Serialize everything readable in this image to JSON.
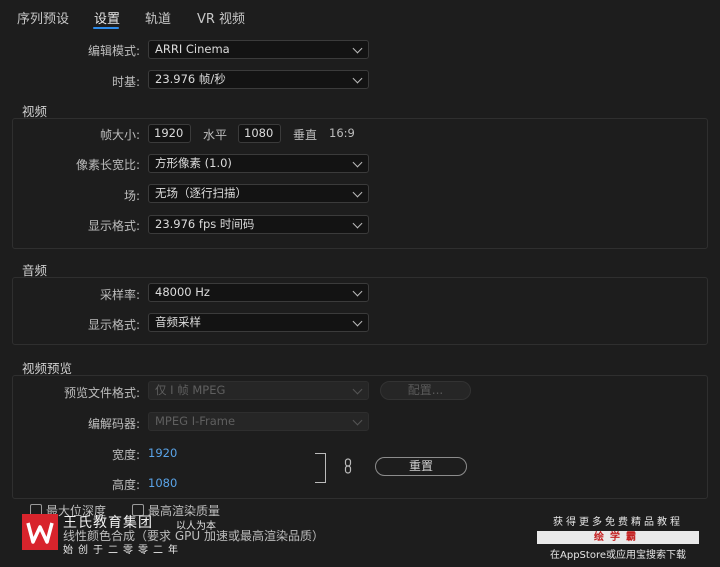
{
  "tabs": [
    "序列预设",
    "设置",
    "轨道",
    "VR 视频"
  ],
  "general": {
    "editing_mode_label": "编辑模式:",
    "editing_mode_value": "ARRI Cinema",
    "timebase_label": "时基:",
    "timebase_value": "23.976  帧/秒"
  },
  "video": {
    "title": "视频",
    "frame_size_label": "帧大小:",
    "width_value": "1920",
    "horizontal_label": "水平",
    "height_value": "1080",
    "vertical_label": "垂直",
    "aspect": "16:9",
    "pixel_aspect_label": "像素长宽比:",
    "pixel_aspect_value": "方形像素 (1.0)",
    "field_label": "场:",
    "field_value": "无场（逐行扫描）",
    "display_format_label": "显示格式:",
    "display_format_value": "23.976 fps 时间码"
  },
  "audio": {
    "title": "音频",
    "sample_rate_label": "采样率:",
    "sample_rate_value": "48000 Hz",
    "display_format_label": "显示格式:",
    "display_format_value": "音频采样"
  },
  "preview": {
    "title": "视频预览",
    "file_format_label": "预览文件格式:",
    "file_format_value": "仅 I 帧 MPEG",
    "configure_label": "配置...",
    "codec_label": "编解码器:",
    "codec_value": "MPEG I-Frame",
    "width_label": "宽度:",
    "width_value": "1920",
    "height_label": "高度:",
    "height_value": "1080",
    "reset_label": "重置"
  },
  "options": {
    "max_bit_depth": "最大位深度",
    "max_render_quality": "最高渲染质量",
    "linear_color": "线性颜色合成（要求 GPU 加速或最高渲染品质）"
  },
  "watermark": {
    "logo_letter": "W",
    "brand": "王氏教育集团",
    "motto": "以人为本",
    "founded": "始创于二零零二年",
    "line1": "获得更多免费精品教程",
    "line2": "绘学霸",
    "line3": "在AppStore或应用宝搜索下载"
  }
}
